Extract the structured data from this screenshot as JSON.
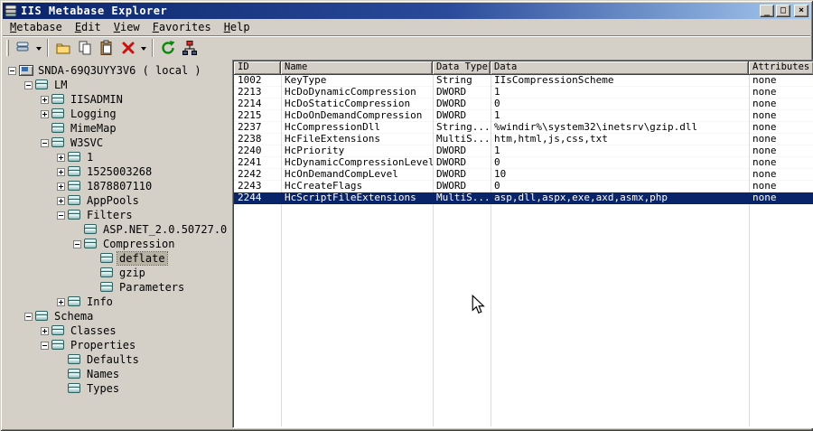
{
  "window": {
    "title": "IIS Metabase Explorer",
    "controls": {
      "minimize": "_",
      "maximize": "□",
      "close": "×"
    }
  },
  "menu": {
    "items": [
      "Metabase",
      "Edit",
      "View",
      "Favorites",
      "Help"
    ]
  },
  "toolbar": {
    "button_names": [
      "new-key",
      "open",
      "copy",
      "paste",
      "delete",
      "refresh",
      "network"
    ]
  },
  "colors": {
    "titlebar_left": "#0a246a",
    "titlebar_right": "#a6caf0",
    "chrome": "#d4d0c8",
    "selection": "#0a246a"
  },
  "tree": {
    "items": [
      {
        "label": "SNDA-69Q3UYY3V6 ( local )",
        "level": 0,
        "expander": "minus",
        "icon": "computer"
      },
      {
        "label": "LM",
        "level": 1,
        "expander": "minus",
        "icon": "keys"
      },
      {
        "label": "IISADMIN",
        "level": 2,
        "expander": "plus",
        "icon": "keys"
      },
      {
        "label": "Logging",
        "level": 2,
        "expander": "plus",
        "icon": "keys"
      },
      {
        "label": "MimeMap",
        "level": 2,
        "expander": "none",
        "icon": "keys"
      },
      {
        "label": "W3SVC",
        "level": 2,
        "expander": "minus",
        "icon": "keys"
      },
      {
        "label": "1",
        "level": 3,
        "expander": "plus",
        "icon": "keys"
      },
      {
        "label": "1525003268",
        "level": 3,
        "expander": "plus",
        "icon": "keys"
      },
      {
        "label": "1878807110",
        "level": 3,
        "expander": "plus",
        "icon": "keys"
      },
      {
        "label": "AppPools",
        "level": 3,
        "expander": "plus",
        "icon": "keys"
      },
      {
        "label": "Filters",
        "level": 3,
        "expander": "minus",
        "icon": "keys"
      },
      {
        "label": "ASP.NET_2.0.50727.0",
        "level": 4,
        "expander": "none",
        "icon": "keys"
      },
      {
        "label": "Compression",
        "level": 4,
        "expander": "minus",
        "icon": "keys"
      },
      {
        "label": "deflate",
        "level": 5,
        "expander": "none",
        "icon": "keys",
        "selected": true
      },
      {
        "label": "gzip",
        "level": 5,
        "expander": "none",
        "icon": "keys"
      },
      {
        "label": "Parameters",
        "level": 5,
        "expander": "none",
        "icon": "keys"
      },
      {
        "label": "Info",
        "level": 3,
        "expander": "plus",
        "icon": "keys"
      },
      {
        "label": "Schema",
        "level": 1,
        "expander": "minus",
        "icon": "keys"
      },
      {
        "label": "Classes",
        "level": 2,
        "expander": "plus",
        "icon": "keys"
      },
      {
        "label": "Properties",
        "level": 2,
        "expander": "minus",
        "icon": "keys"
      },
      {
        "label": "Defaults",
        "level": 3,
        "expander": "none",
        "icon": "keys"
      },
      {
        "label": "Names",
        "level": 3,
        "expander": "none",
        "icon": "keys"
      },
      {
        "label": "Types",
        "level": 3,
        "expander": "none",
        "icon": "keys"
      }
    ]
  },
  "table": {
    "columns": [
      "ID",
      "Name",
      "Data Type",
      "Data",
      "Attributes"
    ],
    "rows": [
      {
        "id": "1002",
        "name": "KeyType",
        "dtype": "String",
        "data": "IIsCompressionScheme",
        "attrs": "none"
      },
      {
        "id": "2213",
        "name": "HcDoDynamicCompression",
        "dtype": "DWORD",
        "data": "1",
        "attrs": "none"
      },
      {
        "id": "2214",
        "name": "HcDoStaticCompression",
        "dtype": "DWORD",
        "data": "0",
        "attrs": "none"
      },
      {
        "id": "2215",
        "name": "HcDoOnDemandCompression",
        "dtype": "DWORD",
        "data": "1",
        "attrs": "none"
      },
      {
        "id": "2237",
        "name": "HcCompressionDll",
        "dtype": "String...",
        "data": "%windir%\\system32\\inetsrv\\gzip.dll",
        "attrs": "none"
      },
      {
        "id": "2238",
        "name": "HcFileExtensions",
        "dtype": "MultiS...",
        "data": "htm,html,js,css,txt",
        "attrs": "none"
      },
      {
        "id": "2240",
        "name": "HcPriority",
        "dtype": "DWORD",
        "data": "1",
        "attrs": "none"
      },
      {
        "id": "2241",
        "name": "HcDynamicCompressionLevel",
        "dtype": "DWORD",
        "data": "0",
        "attrs": "none"
      },
      {
        "id": "2242",
        "name": "HcOnDemandCompLevel",
        "dtype": "DWORD",
        "data": "10",
        "attrs": "none"
      },
      {
        "id": "2243",
        "name": "HcCreateFlags",
        "dtype": "DWORD",
        "data": "0",
        "attrs": "none"
      },
      {
        "id": "2244",
        "name": "HcScriptFileExtensions",
        "dtype": "MultiS...",
        "data": "asp,dll,aspx,exe,axd,asmx,php",
        "attrs": "none",
        "selected": true
      }
    ]
  }
}
